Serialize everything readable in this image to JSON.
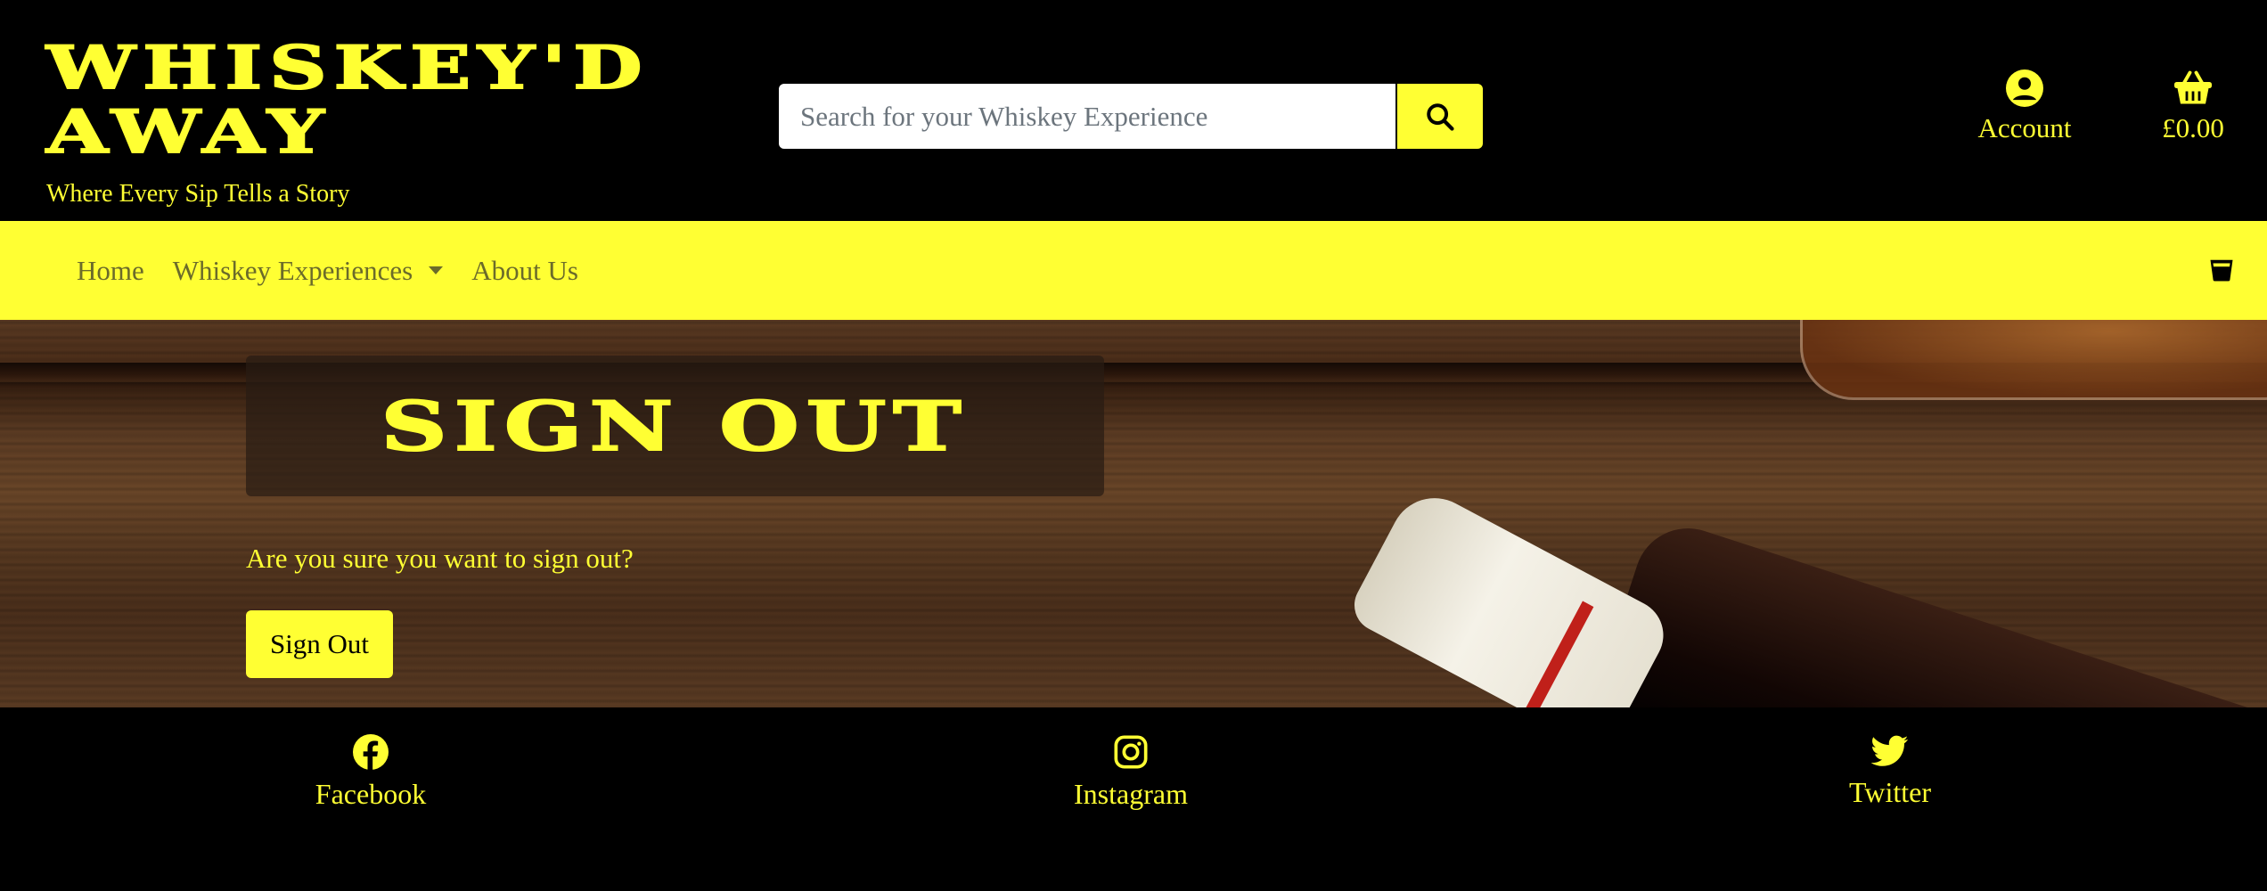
{
  "brand": {
    "title_line1": "Whiskey'd",
    "title_line2": "Away",
    "tagline": "Where Every Sip Tells a Story"
  },
  "search": {
    "placeholder": "Search for your Whiskey Experience",
    "value": "",
    "button_icon": "search-icon"
  },
  "header": {
    "account_label": "Account",
    "account_icon": "user-circle-icon",
    "basket_total": "£0.00",
    "basket_icon": "shopping-basket-icon"
  },
  "nav": {
    "items": [
      {
        "label": "Home"
      },
      {
        "label": "Whiskey Experiences",
        "dropdown": true
      },
      {
        "label": "About Us"
      }
    ],
    "right_icon": "whiskey-glass-icon"
  },
  "main": {
    "title": "Sign Out",
    "question": "Are you sure you want to sign out?",
    "button_label": "Sign Out"
  },
  "footer": {
    "links": [
      {
        "label": "Facebook",
        "icon": "facebook-icon"
      },
      {
        "label": "Instagram",
        "icon": "instagram-icon"
      },
      {
        "label": "Twitter",
        "icon": "twitter-icon"
      }
    ]
  },
  "colors": {
    "accent": "#ffff33",
    "background": "#000000",
    "nav_text": "#6b6b2a"
  }
}
